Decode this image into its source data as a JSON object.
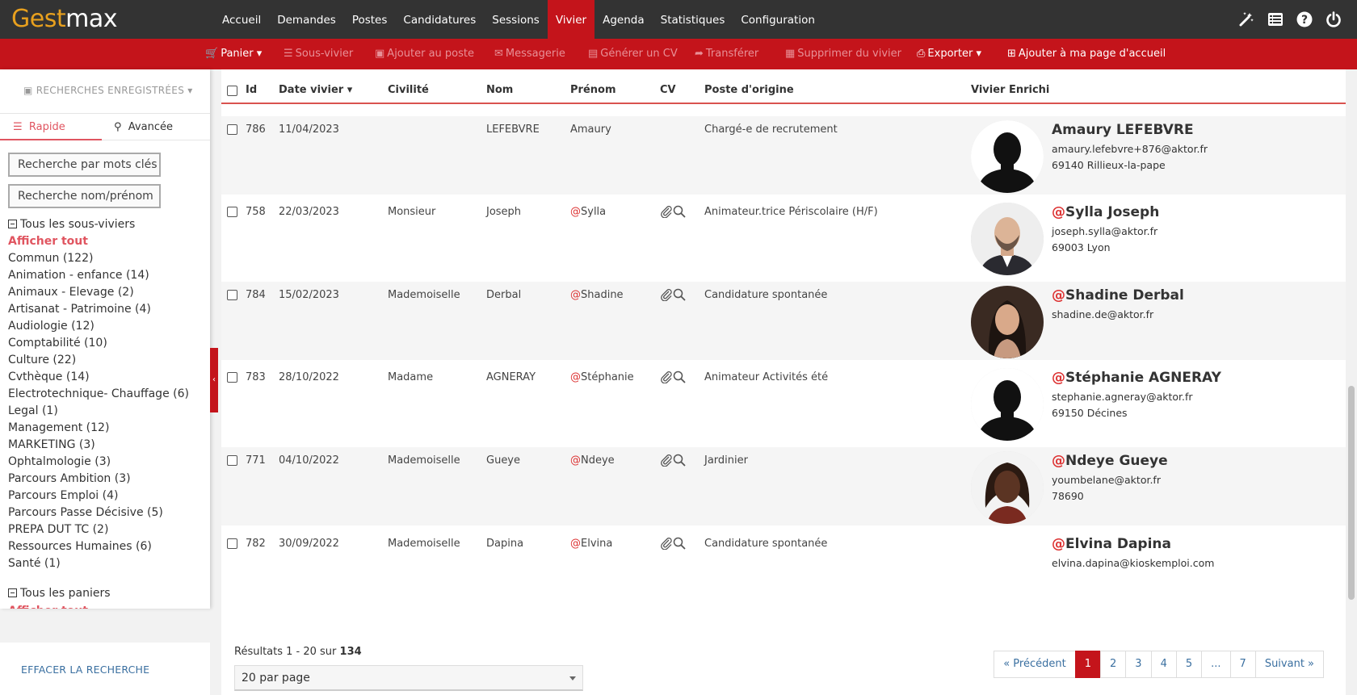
{
  "app": {
    "logo_part1": "Gest",
    "logo_part2": "max"
  },
  "nav": [
    "Accueil",
    "Demandes",
    "Postes",
    "Candidatures",
    "Sessions",
    "Vivier",
    "Agenda",
    "Statistiques",
    "Configuration"
  ],
  "nav_active": "Vivier",
  "top_icons": [
    "magic-wand-icon",
    "list-icon",
    "help-icon",
    "power-icon"
  ],
  "actions": {
    "panier": "Panier",
    "sous_vivier": "Sous-vivier",
    "ajouter_poste": "Ajouter au poste",
    "messagerie": "Messagerie",
    "generer_cv": "Générer un CV",
    "transferer": "Transférer",
    "supprimer": "Supprimer du vivier",
    "exporter": "Exporter",
    "ajouter_accueil": "Ajouter à ma page d'accueil"
  },
  "sidebar": {
    "saved_searches": "RECHERCHES ENREGISTRÉES",
    "tab_rapide": "Rapide",
    "tab_avancee": "Avancée",
    "search_keywords": "Recherche par mots clés",
    "search_name": "Recherche nom/prénom",
    "all_subpools": "Tous les sous-viviers",
    "show_all": "Afficher tout",
    "subpools": [
      "Commun (122)",
      "Animation - enfance (14)",
      "Animaux - Elevage (2)",
      "Artisanat - Patrimoine (4)",
      "Audiologie (12)",
      "Comptabilité (10)",
      "Culture (22)",
      "Cvthèque (14)",
      "Electrotechnique- Chauffage (6)",
      "Legal (1)",
      "Management (12)",
      "MARKETING (3)",
      "Ophtalmologie (3)",
      "Parcours Ambition (3)",
      "Parcours Emploi (4)",
      "Parcours Passe Décisive (5)",
      "PREPA DUT TC (2)",
      "Ressources Humaines (6)",
      "Santé (1)"
    ],
    "all_baskets": "Tous les paniers",
    "clear_search": "EFFACER LA RECHERCHE"
  },
  "table": {
    "headers": {
      "id": "Id",
      "date": "Date vivier",
      "civilite": "Civilité",
      "nom": "Nom",
      "prenom": "Prénom",
      "cv": "CV",
      "poste": "Poste d'origine",
      "enrichi": "Vivier Enrichi"
    },
    "rows": [
      {
        "id": "786",
        "date": "11/04/2023",
        "civilite": "",
        "nom": "LEFEBVRE",
        "prenom": "Amaury",
        "at": false,
        "cv": false,
        "poste": "Chargé-e de recrutement",
        "enrichi_name": "Amaury LEFEBVRE",
        "email": "amaury.lefebvre+876@aktor.fr",
        "city": "69140  Rillieux-la-pape",
        "avatar": "silhouette"
      },
      {
        "id": "758",
        "date": "22/03/2023",
        "civilite": "Monsieur",
        "nom": "Joseph",
        "prenom": "Sylla",
        "at": true,
        "cv": true,
        "poste": "Animateur.trice Périscolaire (H/F)",
        "enrichi_name": "Sylla Joseph",
        "email": "joseph.sylla@aktor.fr",
        "city": "69003  Lyon",
        "avatar": "man"
      },
      {
        "id": "784",
        "date": "15/02/2023",
        "civilite": "Mademoiselle",
        "nom": "Derbal",
        "prenom": "Shadine",
        "at": true,
        "cv": true,
        "poste": "Candidature spontanée",
        "enrichi_name": "Shadine Derbal",
        "email": "shadine.de@aktor.fr",
        "city": "",
        "avatar": "woman1"
      },
      {
        "id": "783",
        "date": "28/10/2022",
        "civilite": "Madame",
        "nom": "AGNERAY",
        "prenom": "Stéphanie",
        "at": true,
        "cv": true,
        "poste": "Animateur Activités été",
        "enrichi_name": "Stéphanie AGNERAY",
        "email": "stephanie.agneray@aktor.fr",
        "city": "69150  Décines",
        "avatar": "silhouette"
      },
      {
        "id": "771",
        "date": "04/10/2022",
        "civilite": "Mademoiselle",
        "nom": "Gueye",
        "prenom": "Ndeye",
        "at": true,
        "cv": true,
        "poste": "Jardinier",
        "enrichi_name": "Ndeye Gueye",
        "email": "youmbelane@aktor.fr",
        "city": "78690",
        "avatar": "woman2"
      },
      {
        "id": "782",
        "date": "30/09/2022",
        "civilite": "Mademoiselle",
        "nom": "Dapina",
        "prenom": "Elvina",
        "at": true,
        "cv": true,
        "poste": "Candidature spontanée",
        "enrichi_name": "Elvina Dapina",
        "email": "elvina.dapina@kioskemploi.com",
        "city": "",
        "avatar": "none"
      }
    ]
  },
  "footer": {
    "results_prefix": "Résultats 1 - 20 sur ",
    "results_total": "134",
    "per_page": "20 par page",
    "pagination": [
      "« Précédent",
      "1",
      "2",
      "3",
      "4",
      "5",
      "...",
      "7",
      "Suivant »"
    ],
    "current_page": "1"
  },
  "colors": {
    "primary": "#c4141b",
    "topbar": "#333333",
    "accent": "#e05560",
    "logo": "#e8a01e"
  }
}
